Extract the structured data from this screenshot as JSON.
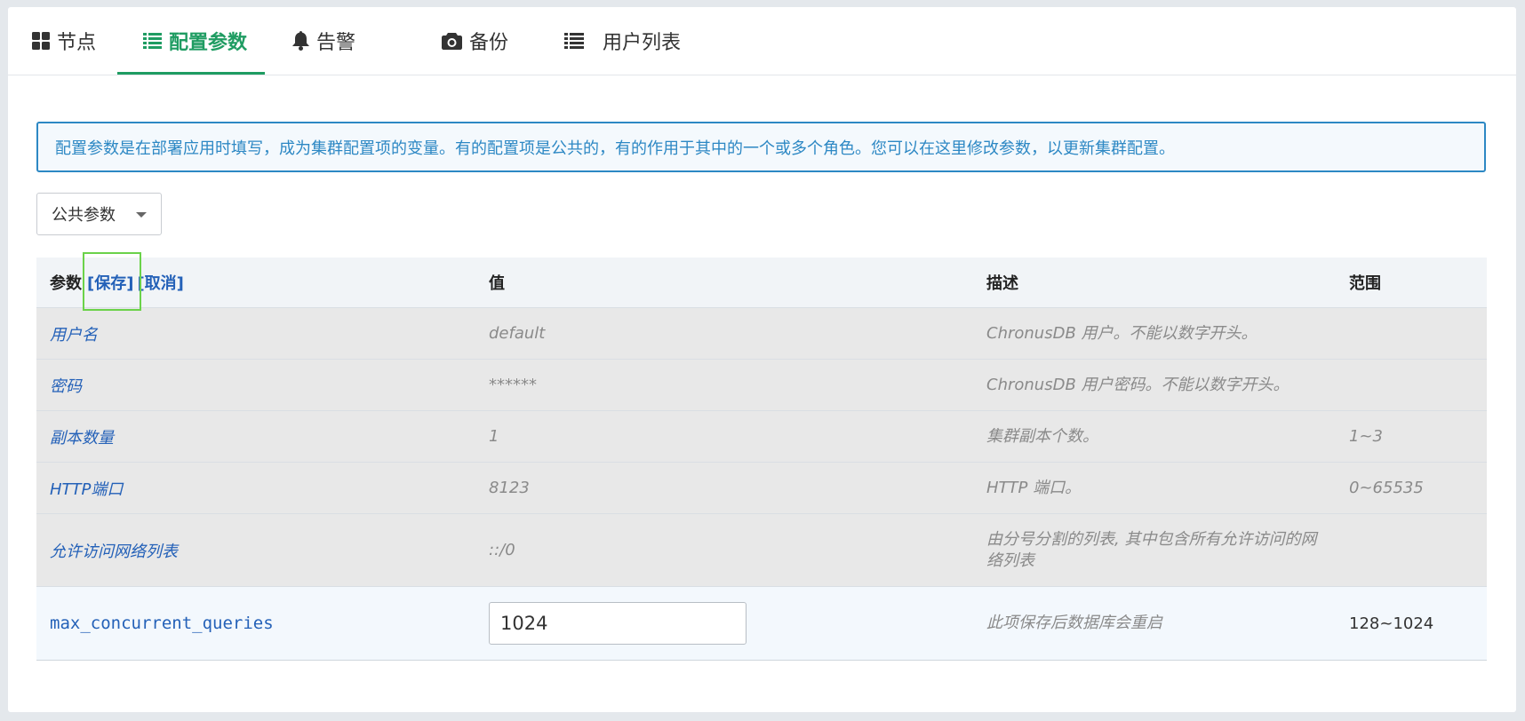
{
  "tabs": [
    {
      "label": "节点",
      "icon": "grid-icon",
      "active": false
    },
    {
      "label": "配置参数",
      "icon": "list-icon",
      "active": true
    },
    {
      "label": "告警",
      "icon": "bell-icon",
      "active": false
    },
    {
      "label": "备份",
      "icon": "camera-icon",
      "active": false
    },
    {
      "label": "用户列表",
      "icon": "list-icon",
      "active": false
    }
  ],
  "info_text": "配置参数是在部署应用时填写，成为集群配置项的变量。有的配置项是公共的，有的作用于其中的一个或多个角色。您可以在这里修改参数，以更新集群配置。",
  "scope_select": {
    "value": "公共参数"
  },
  "table": {
    "headers": {
      "param": "参数",
      "save": "[保存]",
      "cancel": "[取消]",
      "value": "值",
      "desc": "描述",
      "range": "范围"
    },
    "rows": [
      {
        "name": "用户名",
        "value": "default",
        "desc": "ChronusDB 用户。不能以数字开头。",
        "range": ""
      },
      {
        "name": "密码",
        "value": "******",
        "desc": "ChronusDB 用户密码。不能以数字开头。",
        "range": ""
      },
      {
        "name": "副本数量",
        "value": "1",
        "desc": "集群副本个数。",
        "range": "1~3"
      },
      {
        "name": "HTTP端口",
        "value": "8123",
        "desc": "HTTP 端口。",
        "range": "0~65535"
      },
      {
        "name": "允许访问网络列表",
        "value": "::/0",
        "desc": "由分号分割的列表, 其中包含所有允许访问的网络列表",
        "range": ""
      }
    ],
    "edit_row": {
      "name": "max_concurrent_queries",
      "value": "1024",
      "desc": "此项保存后数据库会重启",
      "range": "128~1024"
    }
  },
  "colors": {
    "accent": "#1f9c62",
    "info": "#2d88c4",
    "link": "#2461b8",
    "highlight": "#6bd24a"
  }
}
